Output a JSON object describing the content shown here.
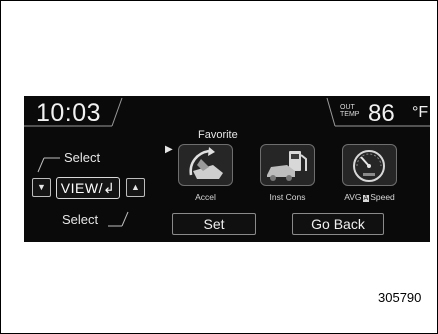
{
  "status": {
    "clock": "10:03",
    "out_temp_label_1": "OUT",
    "out_temp_label_2": "TEMP",
    "out_temp_value": "86",
    "out_temp_unit": "°F"
  },
  "favorite_label": "Favorite",
  "controls": {
    "select_top": "Select",
    "select_bottom": "Select",
    "view_button": "VIEW/↲",
    "down_arrow": "▼",
    "up_arrow": "▲"
  },
  "favorites": [
    {
      "label": "Accel",
      "icon": "accel-pedal-icon"
    },
    {
      "label": "Inst Cons",
      "icon": "fuel-pump-icon"
    },
    {
      "label": "AVG",
      "label_badge": "A",
      "label_tail": "Speed",
      "icon": "speedometer-icon"
    }
  ],
  "buttons": {
    "set": "Set",
    "go_back": "Go Back"
  },
  "figure_ref": "305790"
}
